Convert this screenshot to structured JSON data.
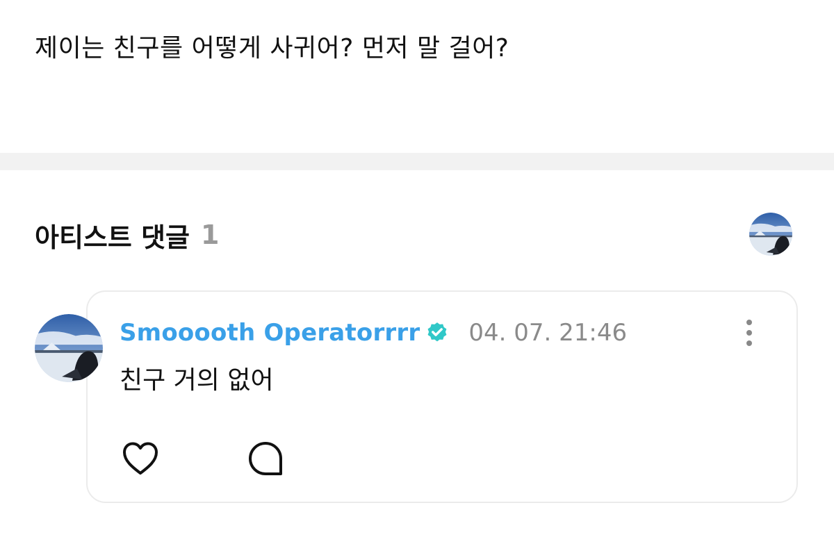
{
  "post": {
    "question": "제이는 친구를 어떻게 사귀어? 먼저 말 걸어?"
  },
  "artist_comments": {
    "title": "아티스트 댓글",
    "count": "1"
  },
  "comment": {
    "author": "Smooooth Operatorrrr",
    "verified": true,
    "timestamp": "04. 07. 21:46",
    "text": "친구 거의 없어",
    "icons": {
      "more": "more-vertical-icon",
      "like": "heart-icon",
      "reply": "speech-bubble-icon",
      "verified": "verified-badge-icon"
    }
  },
  "colors": {
    "author": "#3aa0e8",
    "verified_badge": "#30c8c8",
    "count": "#9a9a9a",
    "timestamp": "#8a8a8a",
    "divider": "#f2f2f2"
  }
}
